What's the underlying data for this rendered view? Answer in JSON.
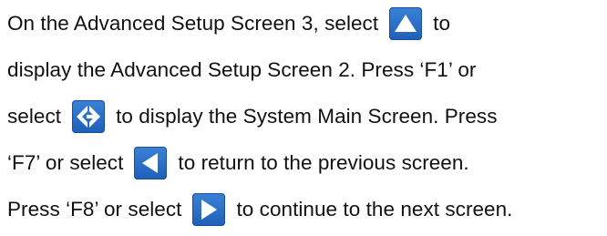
{
  "content": {
    "line1_a": "On the Advanced Setup Screen 3, select",
    "line1_b": "to",
    "line2": "display the Advanced Setup Screen 2. Press ‘F1’ or",
    "line3_a": "select",
    "line3_b": "to display the System Main Screen. Press",
    "line4_a": "‘F7’ or select",
    "line4_b": "to return to the previous screen.",
    "line5_a": "Press ‘F8’ or select",
    "line5_b": "to continue to the next screen."
  },
  "icons": {
    "up": "up-arrow-icon",
    "home": "graco-home-icon",
    "back": "left-arrow-icon",
    "next": "right-arrow-icon"
  },
  "colors": {
    "button": "#2a6fc8",
    "glyph": "#ffffff",
    "text": "#111111"
  }
}
